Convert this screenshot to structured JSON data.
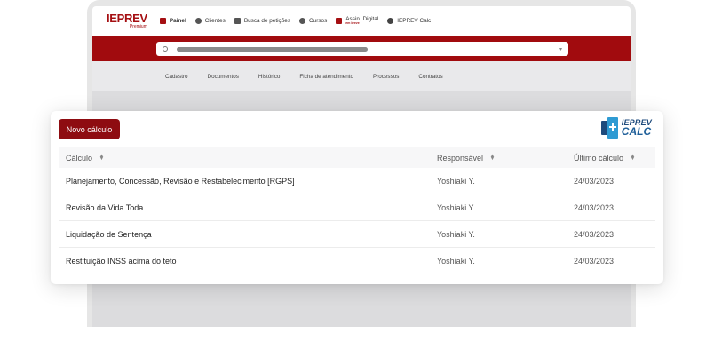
{
  "app": {
    "logo_main": "IEPREV",
    "logo_sub": "Premium"
  },
  "topnav": {
    "items": [
      {
        "label": "Painel",
        "icon": "grid-icon"
      },
      {
        "label": "Clientes",
        "icon": "users-icon"
      },
      {
        "label": "Busca de petições",
        "icon": "document-icon"
      },
      {
        "label": "Cursos",
        "icon": "course-icon"
      },
      {
        "label": "Assin. Digital",
        "sub": "em breve",
        "icon": "signature-icon"
      },
      {
        "label": "IEPREV Calc",
        "icon": "globe-icon"
      }
    ]
  },
  "search": {
    "icon": "search-icon",
    "caret": "chevron-down-icon"
  },
  "subnav": {
    "items": [
      "Cadastro",
      "Documentos",
      "Histórico",
      "Ficha de atendimento",
      "Processos",
      "Contratos"
    ]
  },
  "card": {
    "new_button": "Novo cálculo",
    "calc_logo_line1": "IEPREV",
    "calc_logo_line2": "CALC",
    "columns": [
      "Cálculo",
      "Responsável",
      "Último cálculo"
    ],
    "rows": [
      {
        "name": "Planejamento, Concessão, Revisão e Restabelecimento [RGPS]",
        "owner": "Yoshiaki Y.",
        "date": "24/03/2023"
      },
      {
        "name": "Revisão da Vida Toda",
        "owner": "Yoshiaki Y.",
        "date": "24/03/2023"
      },
      {
        "name": "Liquidação de Sentença",
        "owner": "Yoshiaki Y.",
        "date": "24/03/2023"
      },
      {
        "name": "Restituição INSS acima do teto",
        "owner": "Yoshiaki Y.",
        "date": "24/03/2023"
      }
    ]
  },
  "colors": {
    "brand_red": "#a10b0e",
    "button_red": "#8e0c11",
    "calc_blue": "#1d4a7c",
    "calc_light_blue": "#2f9bd3"
  }
}
